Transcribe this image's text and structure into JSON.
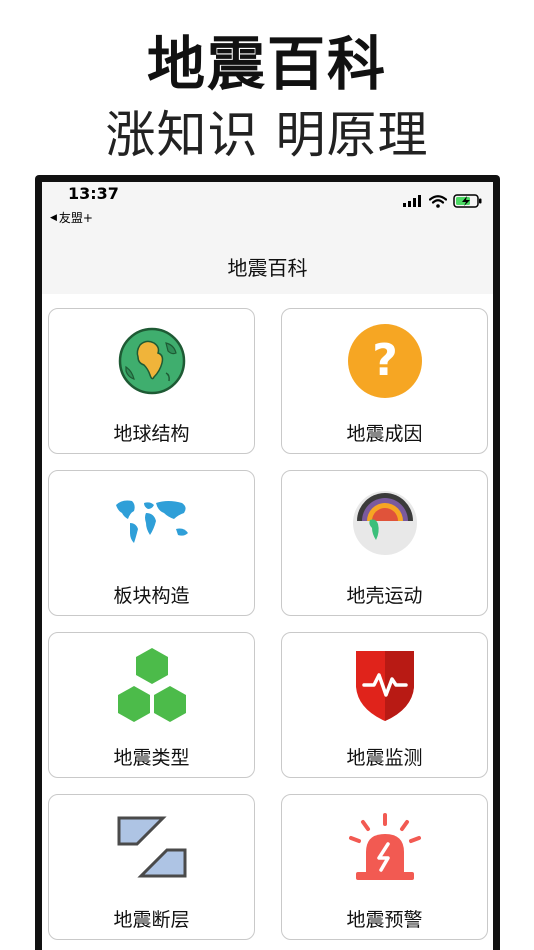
{
  "promo": {
    "title": "地震百科",
    "subtitle": "涨知识 明原理"
  },
  "status_bar": {
    "time": "13:37",
    "back_label": "友盟+"
  },
  "nav": {
    "title": "地震百科"
  },
  "tiles": [
    {
      "label": "地球结构",
      "icon": "globe-icon"
    },
    {
      "label": "地震成因",
      "icon": "question-icon"
    },
    {
      "label": "板块构造",
      "icon": "world-map-icon"
    },
    {
      "label": "地壳运动",
      "icon": "earth-layers-icon"
    },
    {
      "label": "地震类型",
      "icon": "hexagons-icon"
    },
    {
      "label": "地震监测",
      "icon": "shield-pulse-icon"
    },
    {
      "label": "地震断层",
      "icon": "fault-icon"
    },
    {
      "label": "地震预警",
      "icon": "alarm-icon"
    }
  ],
  "colors": {
    "nav_background": "#f5f5f5",
    "tile_border": "#c9c9c9",
    "question_orange": "#f6a623",
    "shield_red": "#e0231b",
    "alarm_red": "#f25a52",
    "hexagon_green": "#4cbb4a",
    "map_blue": "#2f9fd8"
  }
}
